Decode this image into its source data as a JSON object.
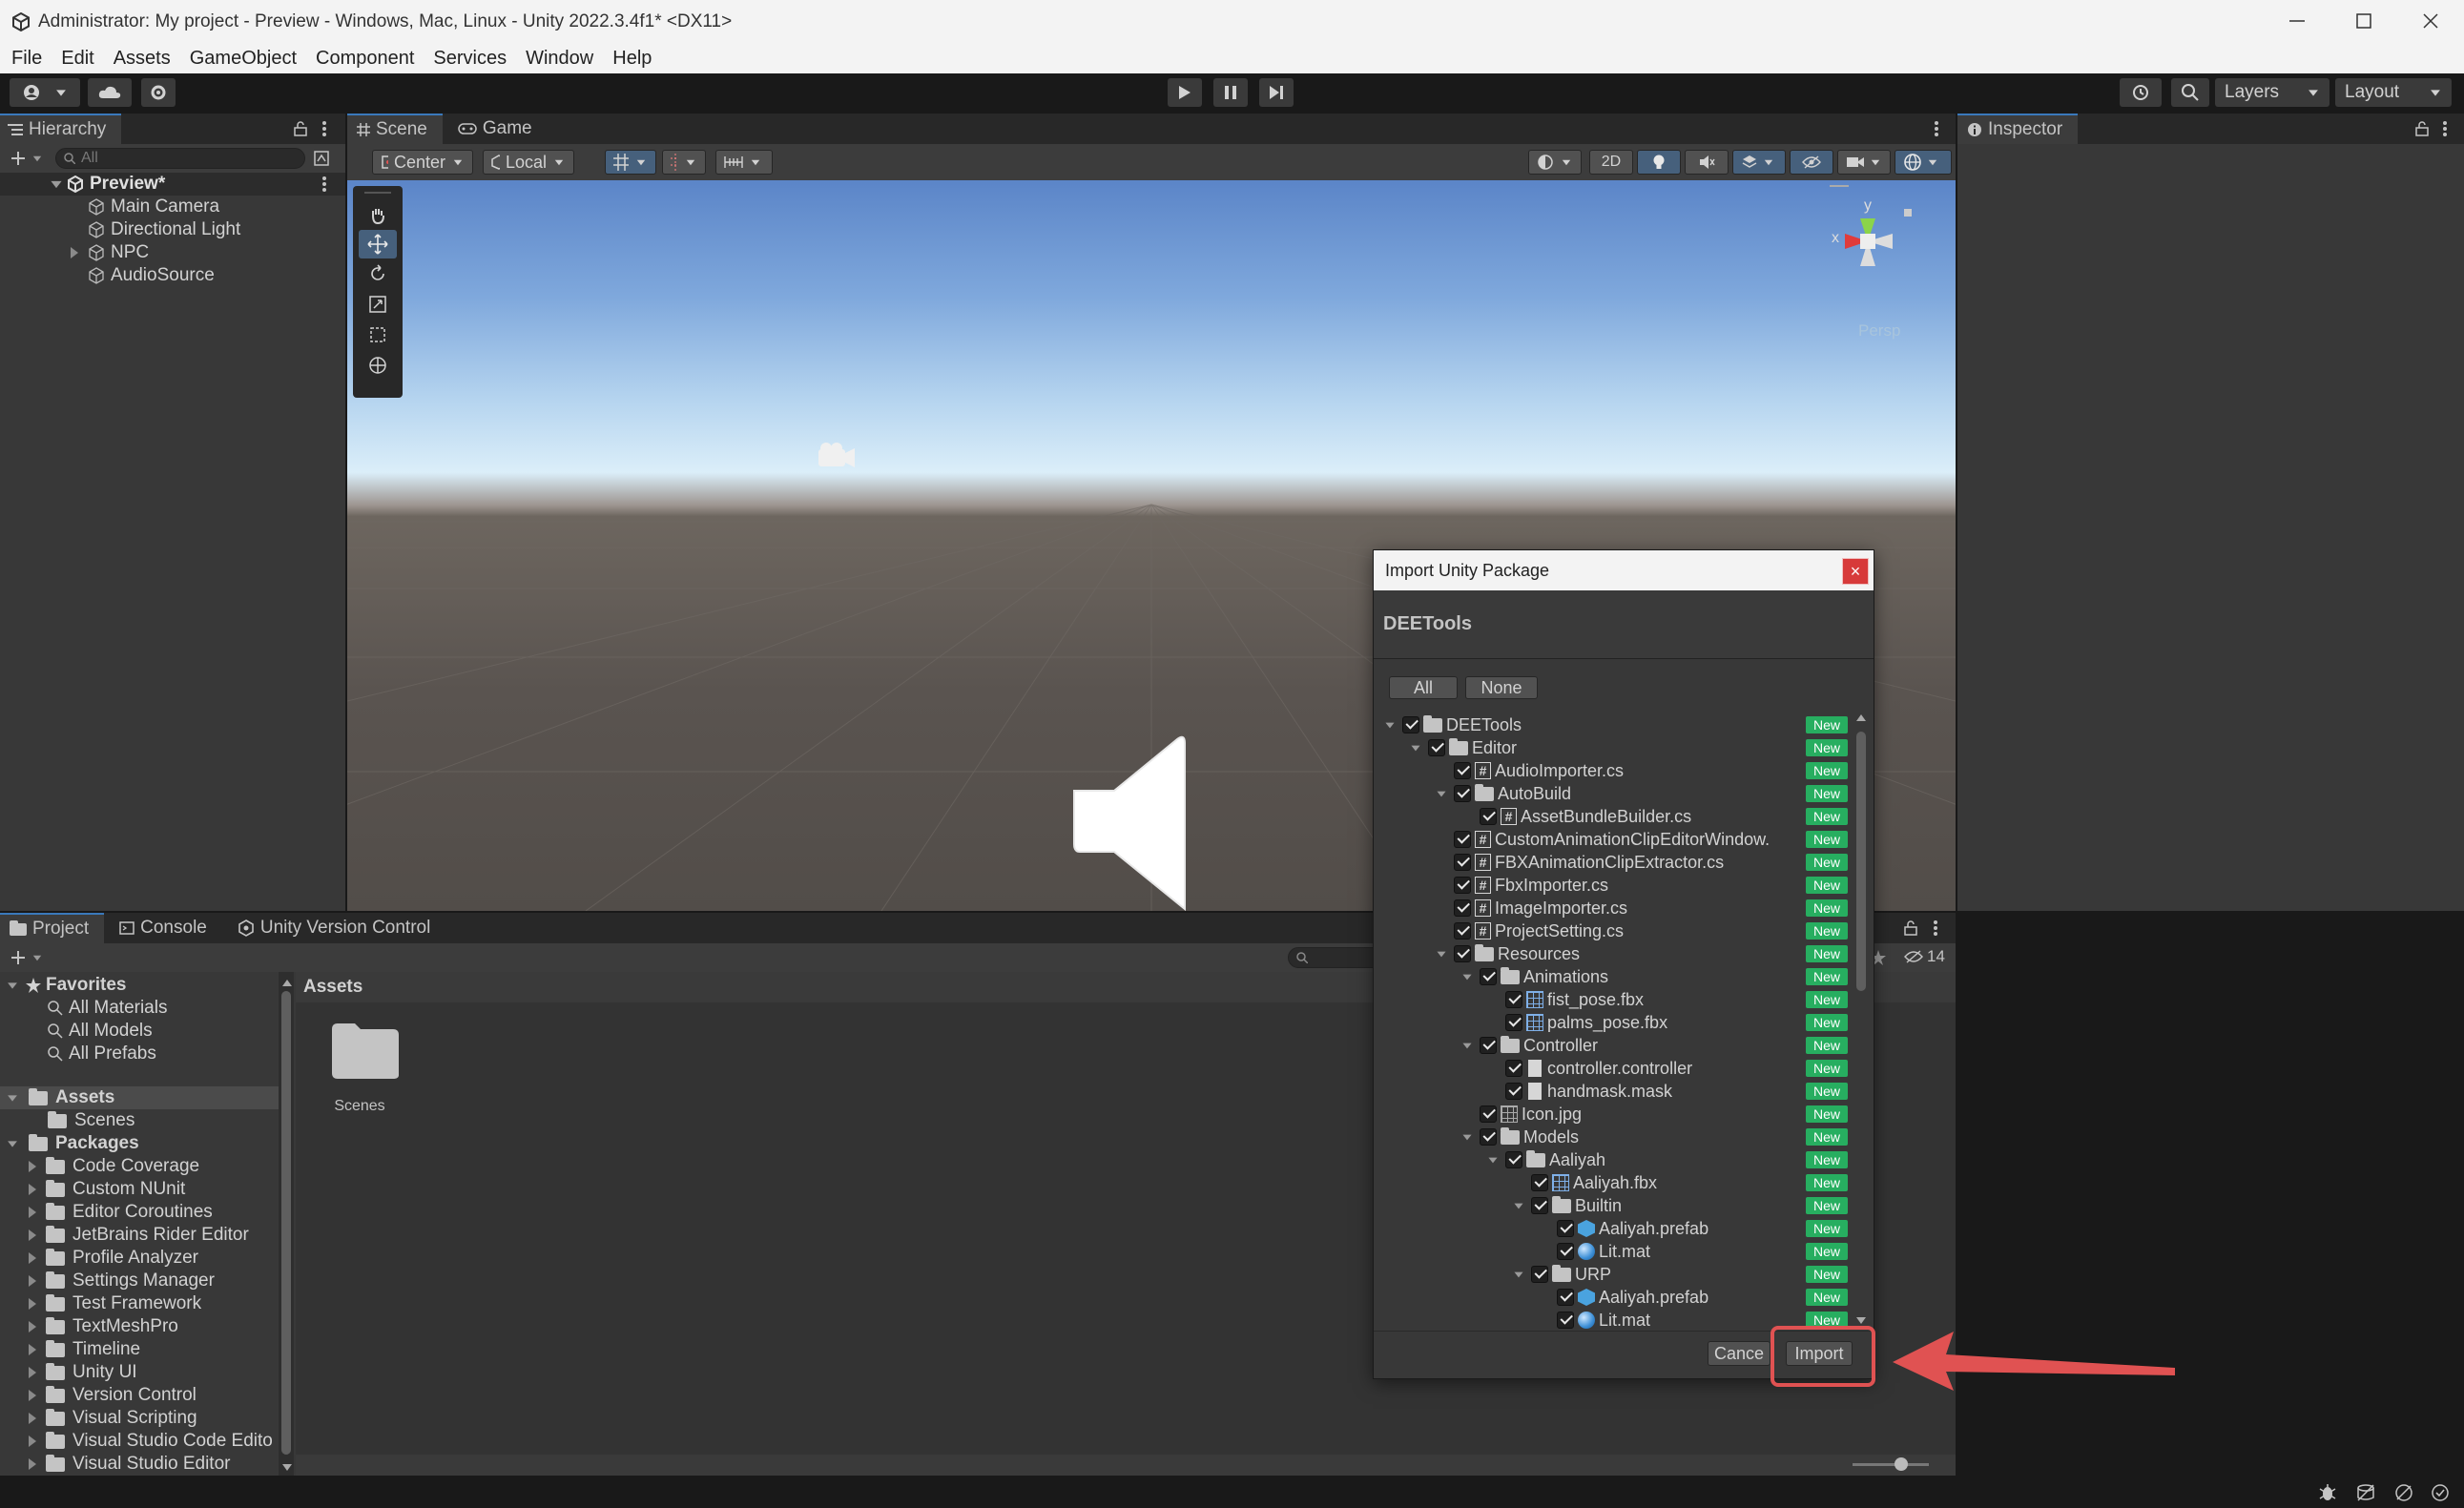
{
  "window": {
    "title": "Administrator: My project - Preview - Windows, Mac, Linux - Unity 2022.3.4f1* <DX11>"
  },
  "menu": [
    "File",
    "Edit",
    "Assets",
    "GameObject",
    "Component",
    "Services",
    "Window",
    "Help"
  ],
  "toolbar": {
    "layers_label": "Layers",
    "layout_label": "Layout"
  },
  "hierarchy": {
    "tab": "Hierarchy",
    "search_placeholder": "All",
    "scene": "Preview*",
    "items": [
      "Main Camera",
      "Directional Light",
      "NPC",
      "AudioSource"
    ]
  },
  "scene_view": {
    "tabs": [
      "Scene",
      "Game"
    ],
    "pivot_label": "Center",
    "space_label": "Local",
    "mode_2d": "2D",
    "persp_label": "Persp",
    "axis_y": "y",
    "axis_x": "x"
  },
  "inspector": {
    "tab": "Inspector"
  },
  "project": {
    "tabs": [
      "Project",
      "Console",
      "Unity Version Control"
    ],
    "favorites_label": "Favorites",
    "favorites": [
      "All Materials",
      "All Models",
      "All Prefabs"
    ],
    "assets_label": "Assets",
    "assets_children": [
      "Scenes"
    ],
    "packages_label": "Packages",
    "packages": [
      "Code Coverage",
      "Custom NUnit",
      "Editor Coroutines",
      "JetBrains Rider Editor",
      "Profile Analyzer",
      "Settings Manager",
      "Test Framework",
      "TextMeshPro",
      "Timeline",
      "Unity UI",
      "Version Control",
      "Visual Scripting",
      "Visual Studio Code Edito",
      "Visual Studio Editor"
    ],
    "breadcrumb": "Assets",
    "grid_items": [
      "Scenes"
    ],
    "hidden_count": "14"
  },
  "dialog": {
    "title": "Import Unity Package",
    "package_name": "DEETools",
    "all_label": "All",
    "none_label": "None",
    "new_badge": "New",
    "cancel_label": "Cance",
    "import_label": "Import",
    "close_glyph": "×",
    "accent_color": "#e05252",
    "badge_color": "#27ae60",
    "tree": [
      {
        "label": "DEETools",
        "depth": 0,
        "icon": "folder",
        "expand": true
      },
      {
        "label": "Editor",
        "depth": 1,
        "icon": "folder",
        "expand": true
      },
      {
        "label": "AudioImporter.cs",
        "depth": 2,
        "icon": "script"
      },
      {
        "label": "AutoBuild",
        "depth": 2,
        "icon": "folder",
        "expand": true
      },
      {
        "label": "AssetBundleBuilder.cs",
        "depth": 3,
        "icon": "script"
      },
      {
        "label": "CustomAnimationClipEditorWindow.",
        "depth": 2,
        "icon": "script"
      },
      {
        "label": "FBXAnimationClipExtractor.cs",
        "depth": 2,
        "icon": "script"
      },
      {
        "label": "FbxImporter.cs",
        "depth": 2,
        "icon": "script"
      },
      {
        "label": "ImageImporter.cs",
        "depth": 2,
        "icon": "script"
      },
      {
        "label": "ProjectSetting.cs",
        "depth": 2,
        "icon": "script"
      },
      {
        "label": "Resources",
        "depth": 2,
        "icon": "folder",
        "expand": true
      },
      {
        "label": "Animations",
        "depth": 3,
        "icon": "folder",
        "expand": true
      },
      {
        "label": "fist_pose.fbx",
        "depth": 4,
        "icon": "model"
      },
      {
        "label": "palms_pose.fbx",
        "depth": 4,
        "icon": "model"
      },
      {
        "label": "Controller",
        "depth": 3,
        "icon": "folder",
        "expand": true
      },
      {
        "label": "controller.controller",
        "depth": 4,
        "icon": "file"
      },
      {
        "label": "handmask.mask",
        "depth": 4,
        "icon": "file"
      },
      {
        "label": "Icon.jpg",
        "depth": 3,
        "icon": "image"
      },
      {
        "label": "Models",
        "depth": 3,
        "icon": "folder",
        "expand": true
      },
      {
        "label": "Aaliyah",
        "depth": 4,
        "icon": "folder",
        "expand": true
      },
      {
        "label": "Aaliyah.fbx",
        "depth": 5,
        "icon": "model"
      },
      {
        "label": "Builtin",
        "depth": 5,
        "icon": "folder",
        "expand": true
      },
      {
        "label": "Aaliyah.prefab",
        "depth": 6,
        "icon": "prefab"
      },
      {
        "label": "Lit.mat",
        "depth": 6,
        "icon": "material"
      },
      {
        "label": "URP",
        "depth": 5,
        "icon": "folder",
        "expand": true
      },
      {
        "label": "Aaliyah.prefab",
        "depth": 6,
        "icon": "prefab"
      },
      {
        "label": "Lit.mat",
        "depth": 6,
        "icon": "material"
      }
    ]
  },
  "annotation": {
    "color": "#e05252"
  }
}
